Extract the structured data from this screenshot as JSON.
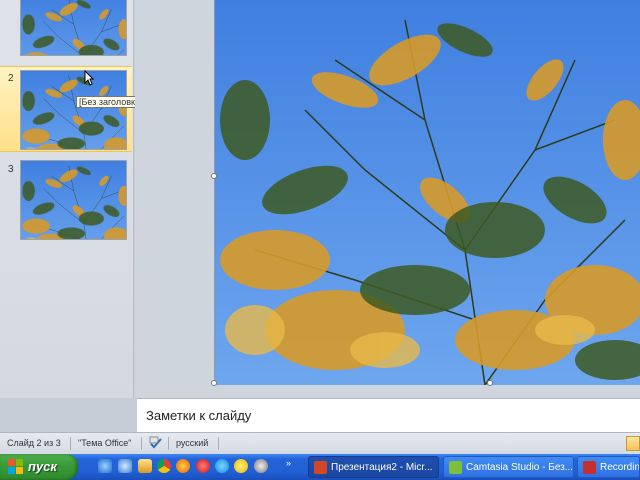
{
  "slides_pane": {
    "slides": [
      {
        "number": "",
        "selected": false
      },
      {
        "number": "2",
        "selected": true
      },
      {
        "number": "3",
        "selected": false
      }
    ],
    "tooltip": "[Без заголовка]"
  },
  "notes": {
    "placeholder": "Заметки к слайду"
  },
  "status_bar": {
    "slide_info": "Слайд 2 из 3",
    "theme": "\"Тема Office\"",
    "language": "русский"
  },
  "taskbar": {
    "start_label": "пуск",
    "quick_launch": [
      "ie-icon",
      "media-icon",
      "folder-icon",
      "chrome-icon",
      "firefox-icon",
      "opera-icon",
      "skype-icon",
      "smiley-icon",
      "app-icon"
    ],
    "tasks": [
      {
        "label": "Презентация2 - Micr...",
        "icon": "powerpoint-icon",
        "active": true
      },
      {
        "label": "Camtasia Studio - Без...",
        "icon": "camtasia-icon",
        "active": false
      },
      {
        "label": "Recording",
        "icon": "recording-icon",
        "active": false
      }
    ]
  },
  "colors": {
    "sky": "#4f8ee6",
    "thumb_selected": "#ffe08a",
    "taskbar_blue": "#245edb",
    "start_green": "#3b9c39"
  }
}
